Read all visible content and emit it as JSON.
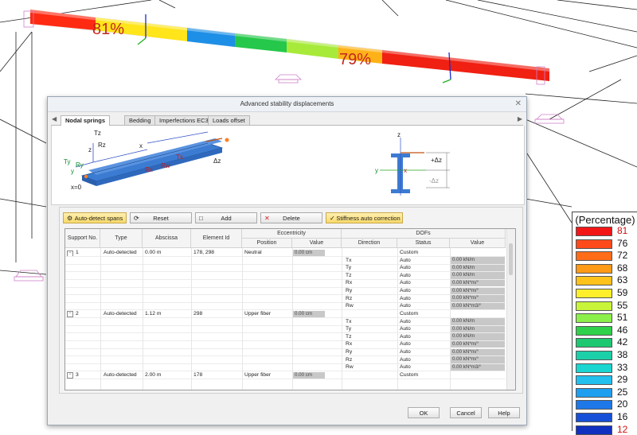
{
  "viewport": {
    "beam_labels": [
      "81%",
      "79%"
    ]
  },
  "legend": {
    "title": "(Percentage)",
    "values": [
      "81",
      "76",
      "72",
      "68",
      "63",
      "59",
      "55",
      "51",
      "46",
      "42",
      "38",
      "33",
      "29",
      "25",
      "20",
      "16",
      "12"
    ],
    "colors": [
      "#f21616",
      "#ff4a1c",
      "#ff6d18",
      "#ff9a16",
      "#ffc21a",
      "#ffef2a",
      "#c8f53a",
      "#8bf04a",
      "#2fd04a",
      "#1ec870",
      "#1bd0a8",
      "#1ad6d0",
      "#22c0ee",
      "#1f9ff0",
      "#1e78e8",
      "#1650d8",
      "#1030c0"
    ]
  },
  "dialog": {
    "title": "Advanced stability displacements",
    "close_icon": "close-icon",
    "tabs": [
      "Nodal springs",
      "Bedding",
      "Imperfections EC3",
      "Loads offset"
    ],
    "active_tab": "Nodal springs",
    "illustration": {
      "beam_labels": [
        "Tz",
        "Rz",
        "x",
        "z",
        "Ty",
        "Ry",
        "y",
        "Rx",
        "Rw",
        "Tx",
        "Δz",
        "x=0"
      ],
      "section_labels": [
        "z",
        "+Δz",
        "y",
        "x",
        "-Δz"
      ]
    },
    "toolbar": {
      "auto_detect_label": "Auto-detect spans",
      "reset_label": "Reset",
      "add_label": "Add",
      "delete_label": "Delete",
      "stiffness_label": "Stiffness auto correction"
    },
    "grid": {
      "group_headers": {
        "eccentricity": "Eccentricity",
        "dofs": "DOFs"
      },
      "columns": [
        "Support No.",
        "Type",
        "Abscissa",
        "Element Id",
        "Position",
        "Value",
        "Direction",
        "Status",
        "Value"
      ],
      "supports": [
        {
          "no": "1",
          "type": "Auto-detected",
          "abscissa": "0.00 m",
          "element_id": "178, 298",
          "position": "Neutral",
          "ecc_value": "0.00 cm",
          "status": "Custom",
          "dofs": [
            {
              "dir": "Tx",
              "status": "Auto",
              "value": "0.00 kN/m"
            },
            {
              "dir": "Ty",
              "status": "Auto",
              "value": "0.00 kN/m"
            },
            {
              "dir": "Tz",
              "status": "Auto",
              "value": "0.00 kN/m"
            },
            {
              "dir": "Rx",
              "status": "Auto",
              "value": "0.00 kN*m/°"
            },
            {
              "dir": "Ry",
              "status": "Auto",
              "value": "0.00 kN*m/°"
            },
            {
              "dir": "Rz",
              "status": "Auto",
              "value": "0.00 kN*m/°"
            },
            {
              "dir": "Rw",
              "status": "Auto",
              "value": "0.00 kN*m3/°"
            }
          ]
        },
        {
          "no": "2",
          "type": "Auto-detected",
          "abscissa": "1.12 m",
          "element_id": "298",
          "position": "Upper fiber",
          "ecc_value": "0.00 cm",
          "status": "Custom",
          "dofs": [
            {
              "dir": "Tx",
              "status": "Auto",
              "value": "0.00 kN/m"
            },
            {
              "dir": "Ty",
              "status": "Auto",
              "value": "0.00 kN/m"
            },
            {
              "dir": "Tz",
              "status": "Auto",
              "value": "0.00 kN/m"
            },
            {
              "dir": "Rx",
              "status": "Auto",
              "value": "0.00 kN*m/°"
            },
            {
              "dir": "Ry",
              "status": "Auto",
              "value": "0.00 kN*m/°"
            },
            {
              "dir": "Rz",
              "status": "Auto",
              "value": "0.00 kN*m/°"
            },
            {
              "dir": "Rw",
              "status": "Auto",
              "value": "0.00 kN*m3/°"
            }
          ]
        },
        {
          "no": "3",
          "type": "Auto-detected",
          "abscissa": "2.00 m",
          "element_id": "178",
          "position": "Upper fiber",
          "ecc_value": "0.00 cm",
          "status": "Custom",
          "dofs": []
        }
      ]
    },
    "buttons": {
      "ok": "OK",
      "cancel": "Cancel",
      "help": "Help"
    }
  }
}
